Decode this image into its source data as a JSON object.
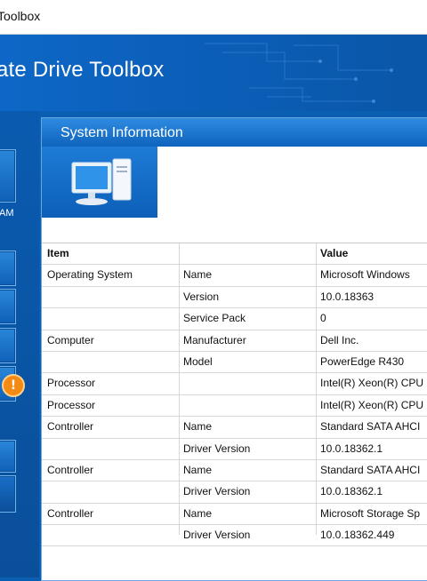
{
  "window": {
    "title": "Toolbox"
  },
  "app": {
    "title": "ate Drive Toolbox"
  },
  "sidebar": {
    "labels": [
      "AM"
    ]
  },
  "panel": {
    "title": "System Information",
    "table": {
      "headers": [
        "Item",
        "",
        "Value"
      ],
      "rows": [
        [
          "Operating System",
          "Name",
          "Microsoft Windows"
        ],
        [
          "",
          "Version",
          "10.0.18363"
        ],
        [
          "",
          "Service Pack",
          "0"
        ],
        [
          "Computer",
          "Manufacturer",
          "Dell Inc."
        ],
        [
          "",
          "Model",
          "PowerEdge R430"
        ],
        [
          "Processor",
          "",
          "Intel(R) Xeon(R) CPU"
        ],
        [
          "Processor",
          "",
          "Intel(R) Xeon(R) CPU"
        ],
        [
          "Controller",
          "Name",
          "Standard SATA AHCI"
        ],
        [
          "",
          "Driver Version",
          "10.0.18362.1"
        ],
        [
          "Controller",
          "Name",
          "Standard SATA AHCI"
        ],
        [
          "",
          "Driver Version",
          "10.0.18362.1"
        ],
        [
          "Controller",
          "Name",
          "Microsoft Storage Sp"
        ],
        [
          "",
          "Driver Version",
          "10.0.18362.449"
        ]
      ]
    }
  },
  "colors": {
    "accent": "#0a5fb3",
    "warning": "#f38a13"
  }
}
